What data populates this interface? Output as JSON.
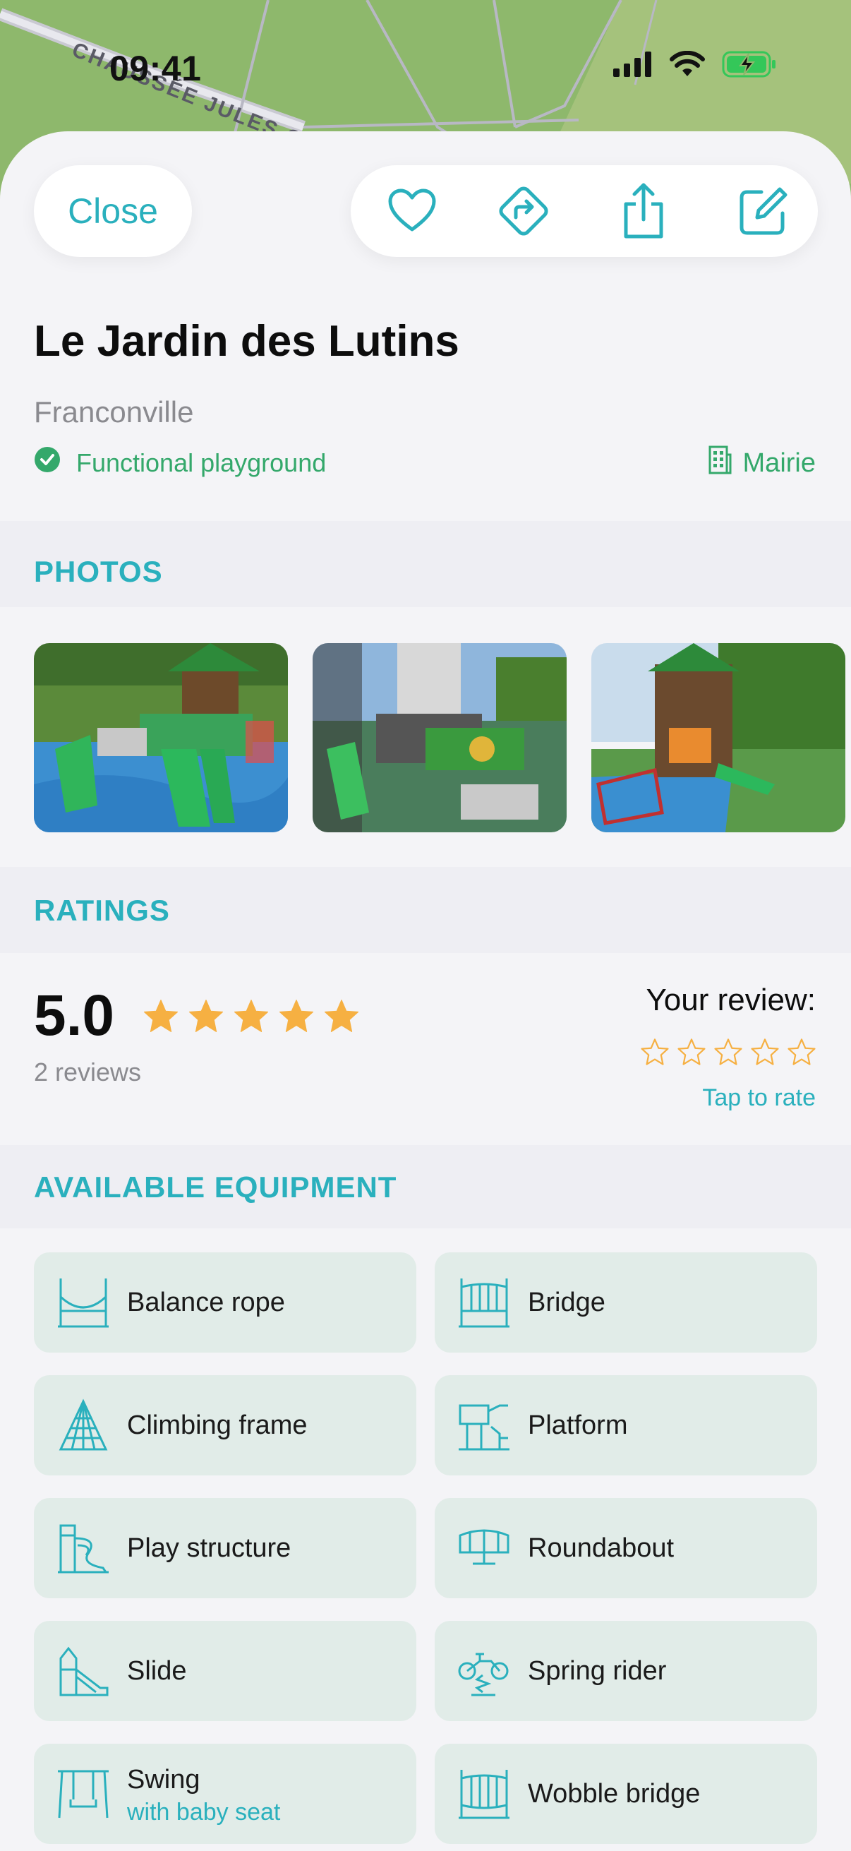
{
  "status_bar": {
    "time": "09:41"
  },
  "map": {
    "street_label": "CHAUSSÉE JULES C..."
  },
  "toolbar": {
    "close_label": "Close",
    "actions": [
      "heart-icon",
      "directions-icon",
      "share-icon",
      "edit-icon"
    ]
  },
  "place": {
    "title": "Le Jardin des Lutins",
    "city": "Franconville",
    "status": "Functional playground",
    "owner": "Mairie"
  },
  "photos": {
    "header": "PHOTOS",
    "items": [
      "photo-1",
      "photo-2",
      "photo-3"
    ]
  },
  "ratings": {
    "header": "RATINGS",
    "average": "5.0",
    "average_value": 5,
    "reviews": "2 reviews",
    "your_review_label": "Your review:",
    "your_review_value": 0,
    "tap_to_rate": "Tap to rate"
  },
  "equipment": {
    "header": "AVAILABLE EQUIPMENT",
    "items": [
      {
        "label": "Balance rope",
        "icon": "balance-rope-icon"
      },
      {
        "label": "Bridge",
        "icon": "bridge-icon"
      },
      {
        "label": "Climbing frame",
        "icon": "climbing-frame-icon"
      },
      {
        "label": "Platform",
        "icon": "platform-icon"
      },
      {
        "label": "Play structure",
        "icon": "play-structure-icon"
      },
      {
        "label": "Roundabout",
        "icon": "roundabout-icon"
      },
      {
        "label": "Slide",
        "icon": "slide-icon"
      },
      {
        "label": "Spring rider",
        "icon": "spring-rider-icon"
      },
      {
        "label": "Swing",
        "sublabel": "with baby seat",
        "icon": "swing-icon"
      },
      {
        "label": "Wobble bridge",
        "icon": "wobble-bridge-icon"
      }
    ]
  },
  "colors": {
    "accent": "#2ab0bd",
    "status_green": "#34a86b",
    "star": "#f6b042",
    "equipment_bg": "#e1ece8"
  }
}
